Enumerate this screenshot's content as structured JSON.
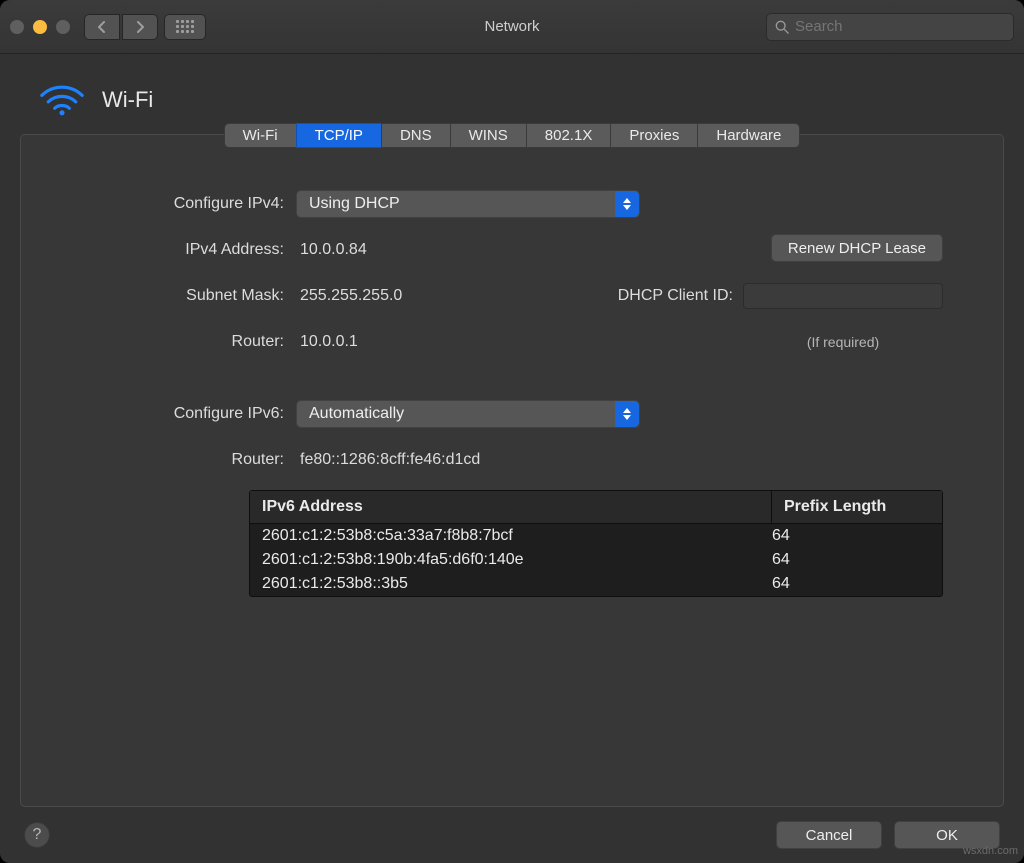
{
  "window": {
    "title": "Network"
  },
  "search": {
    "placeholder": "Search"
  },
  "header": {
    "title": "Wi-Fi"
  },
  "tabs": [
    "Wi-Fi",
    "TCP/IP",
    "DNS",
    "WINS",
    "802.1X",
    "Proxies",
    "Hardware"
  ],
  "active_tab": "TCP/IP",
  "ipv4": {
    "configure_label": "Configure IPv4:",
    "configure_value": "Using DHCP",
    "address_label": "IPv4 Address:",
    "address_value": "10.0.0.84",
    "subnet_label": "Subnet Mask:",
    "subnet_value": "255.255.255.0",
    "router_label": "Router:",
    "router_value": "10.0.0.1",
    "renew_label": "Renew DHCP Lease",
    "client_id_label": "DHCP Client ID:",
    "client_id_hint": "(If required)"
  },
  "ipv6": {
    "configure_label": "Configure IPv6:",
    "configure_value": "Automatically",
    "router_label": "Router:",
    "router_value": "fe80::1286:8cff:fe46:d1cd",
    "table_headers": {
      "address": "IPv6 Address",
      "prefix": "Prefix Length"
    },
    "addresses": [
      {
        "addr": "2601:c1:2:53b8:c5a:33a7:f8b8:7bcf",
        "prefix": "64"
      },
      {
        "addr": "2601:c1:2:53b8:190b:4fa5:d6f0:140e",
        "prefix": "64"
      },
      {
        "addr": "2601:c1:2:53b8::3b5",
        "prefix": "64"
      }
    ]
  },
  "footer": {
    "cancel": "Cancel",
    "ok": "OK"
  },
  "watermark": "wsxdn.com"
}
